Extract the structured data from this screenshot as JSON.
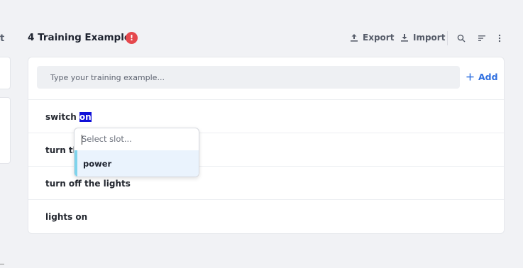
{
  "sidebar": {
    "edge_label": "t"
  },
  "header": {
    "title": "4 Training Examples",
    "warning_badge": "!",
    "export_label": "Export",
    "import_label": "Import",
    "icons": [
      "search-icon",
      "sort-icon",
      "more-vertical-icon"
    ]
  },
  "input": {
    "placeholder": "Type your training example...",
    "add_label": "Add"
  },
  "examples": [
    {
      "before": "switch ",
      "highlight": "on",
      "after": ""
    },
    {
      "text": "turn th"
    },
    {
      "text": "turn off the lights"
    },
    {
      "text": "lights on"
    }
  ],
  "slot_dropdown": {
    "placeholder": "Select slot...",
    "options": [
      "power"
    ]
  },
  "colors": {
    "accent": "#2f6fe0",
    "warning": "#e5484d",
    "selection": "#1010d8",
    "option_highlight": "#eaf3fd",
    "option_bar": "#7fd4ec"
  }
}
